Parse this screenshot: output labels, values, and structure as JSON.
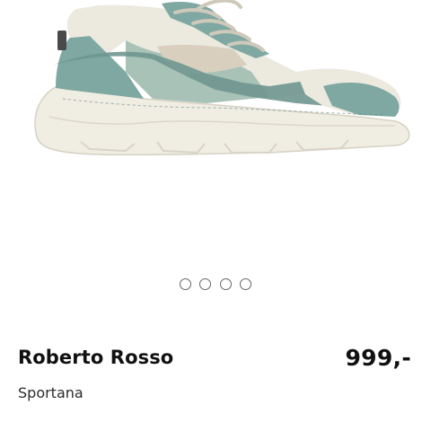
{
  "product": {
    "image_icon": "sneaker-product-photo",
    "brand": "Roberto Rosso",
    "price": "999,-",
    "store": "Sportana",
    "colors": {
      "teal": "#7fa8a2",
      "teal_dark": "#6f9690",
      "sage": "#a9c2b8",
      "cream": "#ece9df",
      "sole": "#f0ede3",
      "sole_shadow": "#d9d4c8",
      "beige": "#d8cfbf"
    }
  },
  "carousel": {
    "dot_count": 4,
    "active_index": null
  }
}
